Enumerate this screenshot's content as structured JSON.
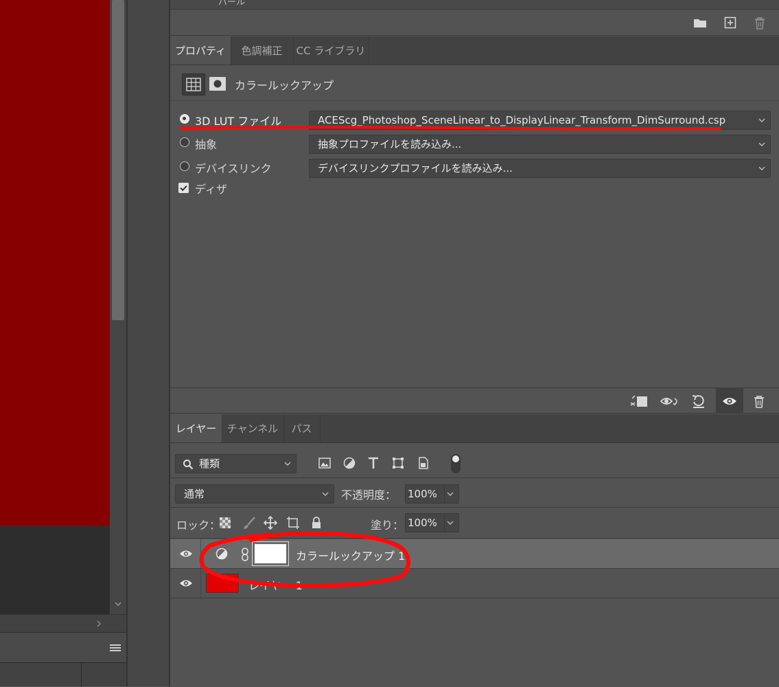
{
  "colors": {
    "canvas_red": "#860000",
    "annotation_red": "#ff0a0a",
    "layer_red_swatch": "#e30000",
    "panel_bg": "#535353"
  },
  "top_strip": {
    "partial_text": "パール"
  },
  "top_toolbar": {
    "icons": [
      "folder-icon",
      "new-item-icon",
      "trash-icon"
    ]
  },
  "properties_tabs": [
    {
      "label": "プロパティ",
      "active": true
    },
    {
      "label": "色調補正",
      "active": false
    },
    {
      "label": "CC ライブラリ",
      "active": false
    }
  ],
  "properties_header": {
    "title": "カラールックアップ"
  },
  "lut_options": [
    {
      "label": "3D LUT ファイル",
      "selected": true,
      "value": "ACEScg_Photoshop_SceneLinear_to_DisplayLinear_Transform_DimSurround.csp"
    },
    {
      "label": "抽象",
      "selected": false,
      "value": "抽象プロファイルを読み込み..."
    },
    {
      "label": "デバイスリンク",
      "selected": false,
      "value": "デバイスリンクプロファイルを読み込み..."
    }
  ],
  "dither": {
    "label": "ディザ",
    "checked": true
  },
  "layers_tabs": [
    {
      "label": "レイヤー",
      "active": true
    },
    {
      "label": "チャンネル",
      "active": false
    },
    {
      "label": "パス",
      "active": false
    }
  ],
  "filter": {
    "kind_label": "種類"
  },
  "blend": {
    "mode": "通常",
    "opacity_label": "不透明度：",
    "opacity_value": "100%"
  },
  "lock": {
    "label": "ロック：",
    "fill_label": "塗り：",
    "fill_value": "100%"
  },
  "layers": [
    {
      "name": "カラールックアップ 1",
      "type": "adjustment",
      "visible": true,
      "selected": true
    },
    {
      "name": "レイヤー 1",
      "type": "pixel",
      "visible": true,
      "selected": false
    }
  ]
}
